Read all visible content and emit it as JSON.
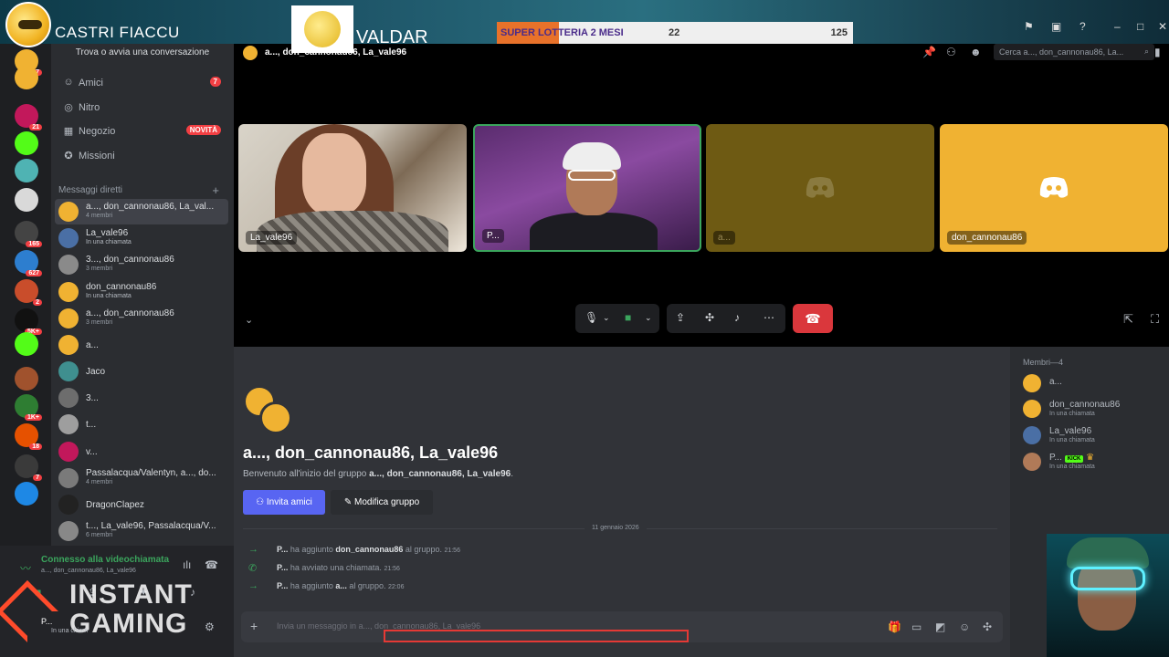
{
  "overlay": {
    "channel_name": "CASTRI FIACCU",
    "valdar": "VALDAR",
    "lottery_label": "SUPER LOTTERIA 2 MESI",
    "lottery_value_1": "22",
    "lottery_value_2": "125",
    "instant_gaming_line1": "INSTANT",
    "instant_gaming_line2": "GAMING"
  },
  "guild_badges": [
    "7",
    "21",
    "165",
    "627",
    "2",
    "5K+",
    "1K+",
    "18",
    "7"
  ],
  "sidebar": {
    "find_placeholder": "Trova o avvia una conversazione",
    "nav": [
      {
        "label": "Amici",
        "icon": "friends-icon",
        "badge": "7"
      },
      {
        "label": "Nitro",
        "icon": "nitro-icon",
        "badge": ""
      },
      {
        "label": "Negozio",
        "icon": "shop-icon",
        "badge": "NOVITÀ"
      },
      {
        "label": "Missioni",
        "icon": "quests-icon",
        "badge": ""
      }
    ],
    "dm_header": "Messaggi diretti",
    "dms": [
      {
        "name": "a..., don_cannonau86, La_val...",
        "sub": "4 membri"
      },
      {
        "name": "La_vale96",
        "sub": "In una chiamata"
      },
      {
        "name": "3..., don_cannonau86",
        "sub": "3 membri"
      },
      {
        "name": "don_cannonau86",
        "sub": "In una chiamata"
      },
      {
        "name": "a..., don_cannonau86",
        "sub": "3 membri"
      },
      {
        "name": "a...",
        "sub": ""
      },
      {
        "name": "Jaco",
        "sub": ""
      },
      {
        "name": "3...",
        "sub": ""
      },
      {
        "name": "t...",
        "sub": ""
      },
      {
        "name": "v...",
        "sub": ""
      },
      {
        "name": "Passalacqua/Valentyn, a..., do...",
        "sub": "4 membri"
      },
      {
        "name": "DragonClapez",
        "sub": ""
      },
      {
        "name": "t..., La_vale96, Passalacqua/V...",
        "sub": "6 membri"
      }
    ]
  },
  "voice": {
    "status": "Connesso alla videochiamata",
    "channel": "a..., don_cannonau86, La_vale96",
    "user_name": "P...",
    "user_status": "In una chiam"
  },
  "header": {
    "title": "a..., don_cannonau86, La_vale96",
    "search_placeholder": "Cerca a..., don_cannonau86, La..."
  },
  "video_tiles": [
    {
      "label": "La_vale96"
    },
    {
      "label": "P..."
    },
    {
      "label": "a..."
    },
    {
      "label": "don_cannonau86"
    }
  ],
  "chat": {
    "group_title": "a..., don_cannonau86, La_vale96",
    "welcome_prefix": "Benvenuto all'inizio del gruppo ",
    "welcome_group": "a..., don_cannonau86, La_vale96",
    "welcome_suffix": ".",
    "invite_button": "Invita amici",
    "edit_button": "Modifica gruppo",
    "date_divider": "11 gennaio 2026",
    "messages": [
      {
        "user": "P...",
        "mid": " ha aggiunto ",
        "target": "don_cannonau86",
        "end": " al gruppo. ",
        "time": "21:56"
      },
      {
        "user": "P...",
        "mid": " ha avviato una chiamata. ",
        "target": "",
        "end": "",
        "time": "21:56"
      },
      {
        "user": "P...",
        "mid": " ha aggiunto ",
        "target": "a...",
        "end": " al gruppo. ",
        "time": "22:06"
      }
    ],
    "composer_placeholder": "Invia un messaggio in a..., don_cannonau86, La_vale96"
  },
  "members": {
    "header": "Membri—4",
    "list": [
      {
        "name": "a...",
        "sub": ""
      },
      {
        "name": "don_cannonau86",
        "sub": "In una chiamata"
      },
      {
        "name": "La_vale96",
        "sub": "In una chiamata"
      },
      {
        "name": "P...",
        "sub": "In una chiamata",
        "tag": "KICK"
      }
    ]
  },
  "colors": {
    "accent": "#5865f2",
    "online": "#3ba55d",
    "danger": "#da373c",
    "discord_yellow": "#f0b232"
  }
}
